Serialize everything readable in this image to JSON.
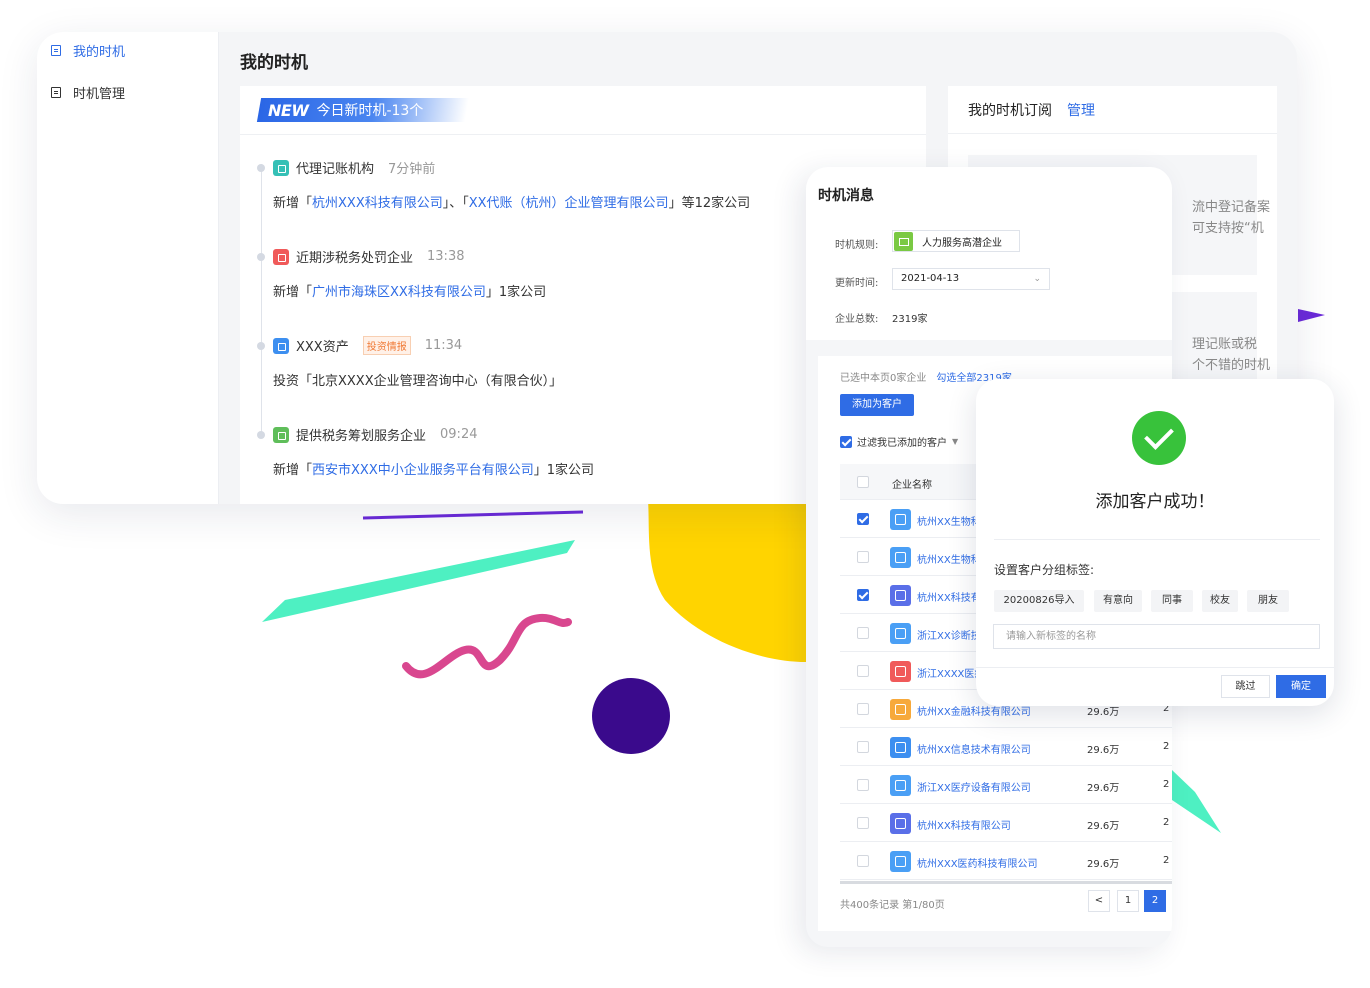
{
  "colors": {
    "accent": "#2f6ce5",
    "success": "#38c23b",
    "deco_yellow": "#ffd400",
    "deco_purple": "#3a0a8c",
    "deco_pink": "#d9478f",
    "deco_mint": "#4ef0c2"
  },
  "sidebar": {
    "items": [
      {
        "label": "我的时机",
        "icon": "document-icon",
        "active": true
      },
      {
        "label": "时机管理",
        "icon": "document-icon",
        "active": false
      }
    ]
  },
  "page": {
    "title": "我的时机"
  },
  "feed": {
    "banner_new": "NEW",
    "banner_text": "今日新时机-13个",
    "items": [
      {
        "title": "代理记账机构",
        "time": "7分钟前",
        "tag": "",
        "icon": "building-icon",
        "icon_color": "#35c0b6",
        "desc_parts": [
          {
            "text": "新增「",
            "link": false
          },
          {
            "text": "杭州XXX科技有限公司",
            "link": true
          },
          {
            "text": "」、「",
            "link": false
          },
          {
            "text": "XX代账（杭州）企业管理有限公司",
            "link": true
          },
          {
            "text": "」等12家公司",
            "link": false
          }
        ]
      },
      {
        "title": "近期涉税务处罚企业",
        "time": "13:38",
        "tag": "",
        "icon": "warning-icon",
        "icon_color": "#f05a5a",
        "desc_parts": [
          {
            "text": "新增「",
            "link": false
          },
          {
            "text": "广州市海珠区XX科技有限公司",
            "link": true
          },
          {
            "text": "」1家公司",
            "link": false
          }
        ]
      },
      {
        "title": "XXX资产",
        "time": "11:34",
        "tag": "投资情报",
        "icon": "asset-icon",
        "icon_color": "#3d8ff0",
        "desc_parts": [
          {
            "text": "投资「北京XXXX企业管理咨询中心（有限合伙）」",
            "link": false
          }
        ]
      },
      {
        "title": "提供税务筹划服务企业",
        "time": "09:24",
        "tag": "",
        "icon": "service-icon",
        "icon_color": "#5fbe5a",
        "desc_parts": [
          {
            "text": "新增「",
            "link": false
          },
          {
            "text": "西安市XXX中小企业服务平台有限公司",
            "link": true
          },
          {
            "text": "」1家公司",
            "link": false
          }
        ]
      }
    ]
  },
  "subscription": {
    "title": "我的时机订阅",
    "manage": "管理",
    "box1_lines": [
      "流中登记备案",
      "可支持按“机"
    ],
    "box2_lines": [
      "理记账或税",
      "个不错的时机"
    ]
  },
  "message_panel": {
    "title": "时机消息",
    "rule_label": "时机规则:",
    "rule_value": "人力服务高潜企业",
    "update_label": "更新时间:",
    "update_value": "2021-04-13",
    "total_label": "企业总数:",
    "total_value": "2319家",
    "selected_info": "已选中本页0家企业",
    "select_all": "勾选全部2319家",
    "add_button": "添加为客户",
    "filter_label": "过滤我已添加的客户",
    "col_name": "企业名称",
    "rows": [
      {
        "name": "杭州XX生物科",
        "capital": "",
        "year": "",
        "checked": true,
        "logo": "company-logo-icon",
        "logo_color": "#4a9ff5"
      },
      {
        "name": "杭州XX生物科",
        "capital": "",
        "year": "",
        "checked": false,
        "logo": "company-logo-icon",
        "logo_color": "#4a9ff5"
      },
      {
        "name": "杭州XX科技有",
        "capital": "",
        "year": "",
        "checked": true,
        "logo": "globe-icon",
        "logo_color": "#5a6fe8"
      },
      {
        "name": "浙江XX诊断技",
        "capital": "",
        "year": "",
        "checked": false,
        "logo": "company-logo-icon",
        "logo_color": "#4a9ff5"
      },
      {
        "name": "浙江XXXX医疗",
        "capital": "",
        "year": "",
        "checked": false,
        "logo": "hospital-icon",
        "logo_color": "#f05a5a"
      },
      {
        "name": "杭州XX金融科技有限公司",
        "capital": "29.6万",
        "year": "2",
        "checked": false,
        "logo": "finance-icon",
        "logo_color": "#f7a93b"
      },
      {
        "name": "杭州XX信息技术有限公司",
        "capital": "29.6万",
        "year": "2",
        "checked": false,
        "logo": "building-icon",
        "logo_color": "#3d8ff0"
      },
      {
        "name": "浙江XX医疗设备有限公司",
        "capital": "29.6万",
        "year": "2",
        "checked": false,
        "logo": "company-logo-icon",
        "logo_color": "#4a9ff5"
      },
      {
        "name": "杭州XX科技有限公司",
        "capital": "29.6万",
        "year": "2",
        "checked": false,
        "logo": "globe-icon",
        "logo_color": "#5a6fe8"
      },
      {
        "name": "杭州XXX医药科技有限公司",
        "capital": "29.6万",
        "year": "2",
        "checked": false,
        "logo": "company-logo-icon",
        "logo_color": "#4a9ff5"
      }
    ],
    "pager_text": "共400条记录 第1/80页",
    "prev_glyph": "<",
    "pages": [
      "1",
      "2"
    ],
    "current_page": "2"
  },
  "dialog": {
    "title": "添加客户成功！",
    "subtitle": "设置客户分组标签:",
    "tags": [
      "20200826导入",
      "有意向",
      "同事",
      "校友",
      "朋友"
    ],
    "input_placeholder": "请输入新标签的名称",
    "skip": "跳过",
    "confirm": "确定"
  }
}
